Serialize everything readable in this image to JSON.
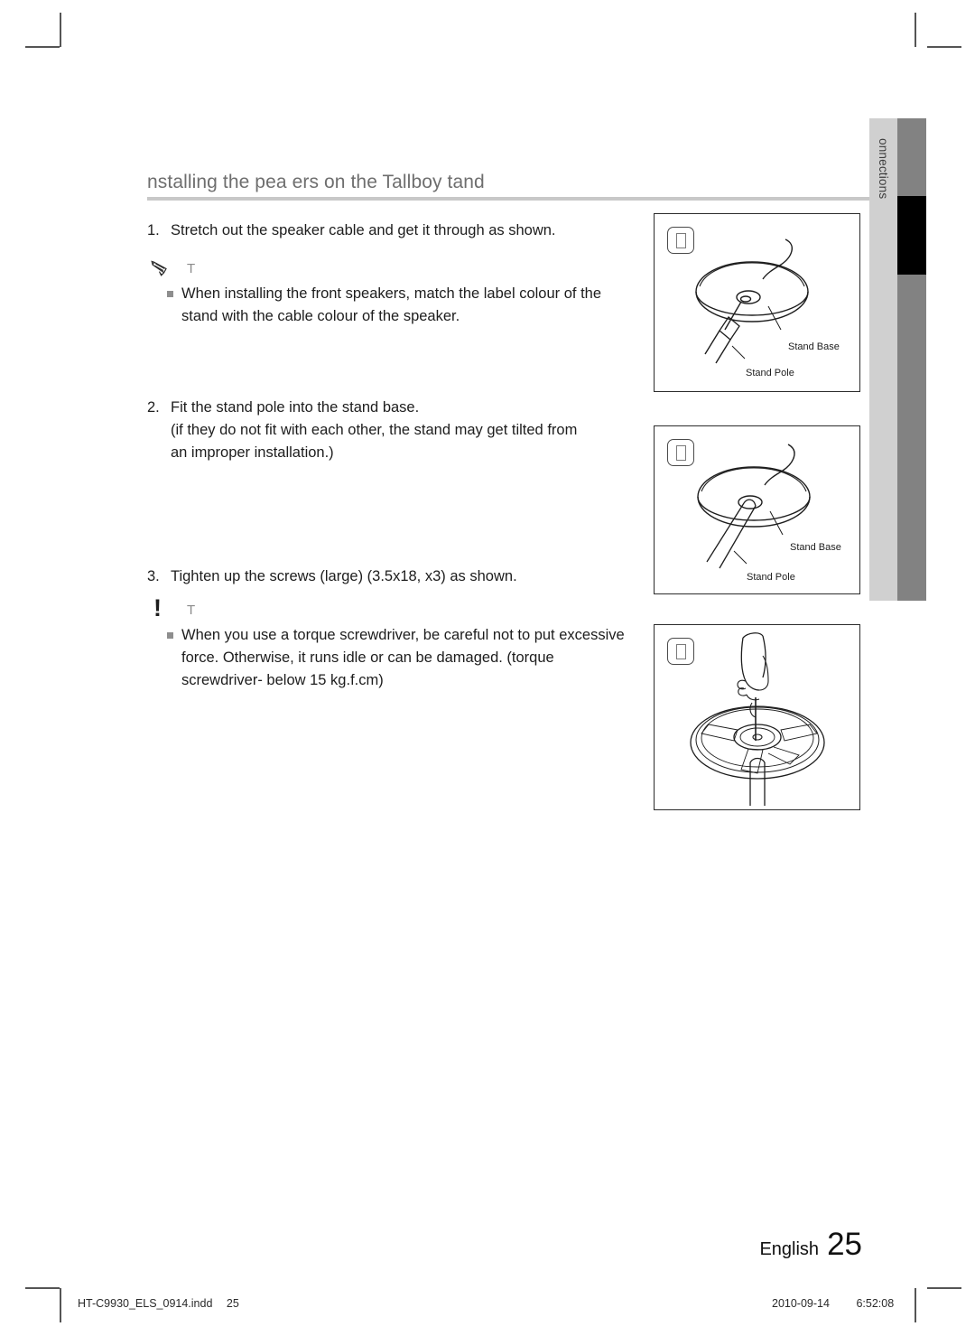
{
  "document": {
    "heading": "nstalling the  pea ers on the Tallboy  tand",
    "language_label": "English",
    "page_number": "25",
    "chapter_tab_label": "onnections"
  },
  "steps": [
    {
      "number": "1.",
      "lines": [
        "Stretch out the speaker cable and get it through as shown."
      ]
    },
    {
      "number": "2.",
      "lines": [
        "Fit the stand pole into the stand base.",
        "(if they do not fit with each other, the stand may get tilted from",
        "an improper installation.)"
      ]
    },
    {
      "number": "3.",
      "lines": [
        "Tighten up the screws (large) (3.5x18, x3) as shown."
      ]
    }
  ],
  "note": {
    "title": "T",
    "icon": "pencil-icon",
    "items": [
      "When installing the front speakers, match the label colour of the stand with the cable colour of the speaker."
    ]
  },
  "caution": {
    "title": "T",
    "mark": "!",
    "icon": "exclamation-icon",
    "items": [
      "When you use a torque screwdriver, be careful not to put excessive force. Otherwise, it runs idle or can be damaged. (torque screwdriver- below 15 kg.f.cm)"
    ]
  },
  "panels": [
    {
      "badge": "□",
      "labels": {
        "base": "Stand Base",
        "pole": "Stand Pole"
      }
    },
    {
      "badge": "□",
      "labels": {
        "base": "Stand Base",
        "pole": "Stand Pole"
      }
    },
    {
      "badge": "□",
      "labels": {
        "base": "",
        "pole": ""
      }
    }
  ],
  "print_info": {
    "file": "HT-C9930_ELS_0914.indd",
    "folio": "25",
    "date": "2010-09-14",
    "time": "6:52:08"
  },
  "colors": {
    "heading_text": "#6e6e6e",
    "heading_rule": "#c8c8c8",
    "tab_light": "#d0d0d0",
    "tab_bar": "#828282",
    "tab_active": "#000000",
    "body_text": "#1d1d1d",
    "bullet": "#8e8e8e"
  }
}
